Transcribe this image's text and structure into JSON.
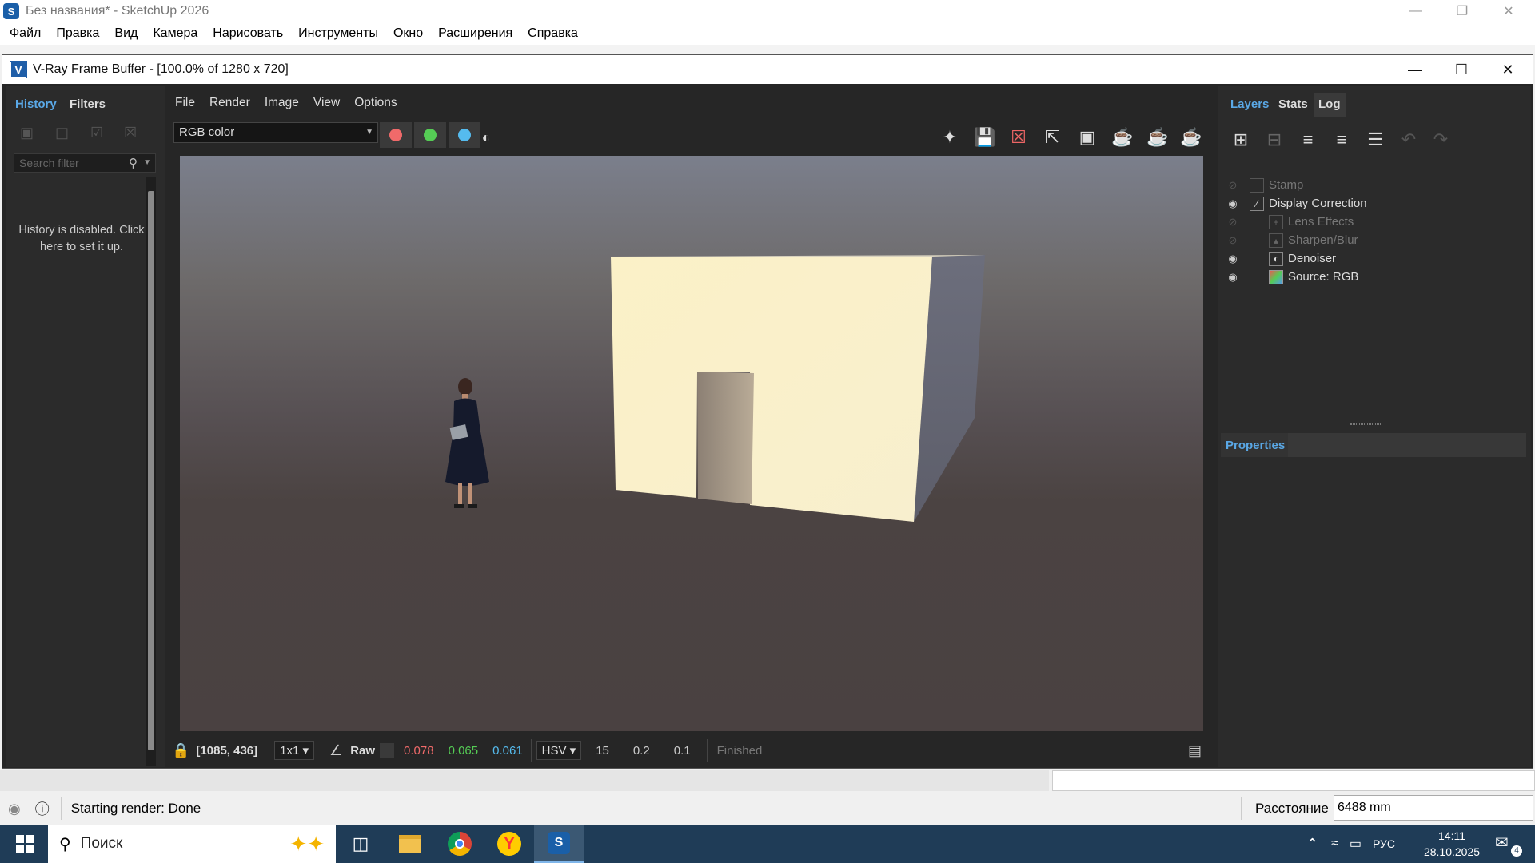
{
  "sketchup": {
    "title": "Без названия* - SketchUp 2026",
    "menu": [
      "Файл",
      "Правка",
      "Вид",
      "Камера",
      "Нарисовать",
      "Инструменты",
      "Окно",
      "Расширения",
      "Справка"
    ],
    "status_text": "Starting render: Done",
    "distance_label": "Расстояние",
    "distance_value": "6488 mm"
  },
  "vfb": {
    "title": "V-Ray Frame Buffer - [100.0% of 1280 x 720]",
    "left_tabs": [
      "History",
      "Filters"
    ],
    "search_placeholder": "Search filter",
    "history_message": "History is disabled. Click here to set it up.",
    "menu": [
      "File",
      "Render",
      "Image",
      "View",
      "Options"
    ],
    "channel": "RGB color",
    "channel_colors": {
      "red": "#f06a6a",
      "green": "#55cc55",
      "blue": "#55bbee"
    },
    "status": {
      "coords": "[1085, 436]",
      "scale": "1x1",
      "raw_label": "Raw",
      "r": "0.078",
      "g": "0.065",
      "b": "0.061",
      "colorspace": "HSV",
      "h": "15",
      "s": "0.2",
      "v": "0.1",
      "state": "Finished"
    },
    "right_tabs": [
      "Layers",
      "Stats",
      "Log"
    ],
    "layers": [
      {
        "name": "Stamp",
        "visible": false,
        "icon": "stamp-icon"
      },
      {
        "name": "Display Correction",
        "visible": true,
        "icon": "curve-icon"
      },
      {
        "name": "Lens Effects",
        "visible": false,
        "icon": "lens-icon"
      },
      {
        "name": "Sharpen/Blur",
        "visible": false,
        "icon": "sharpen-icon"
      },
      {
        "name": "Denoiser",
        "visible": true,
        "icon": "denoiser-icon"
      },
      {
        "name": "Source: RGB",
        "visible": true,
        "icon": "source-icon"
      }
    ],
    "properties_label": "Properties"
  },
  "taskbar": {
    "search_label": "Поиск",
    "lang": "РУС",
    "time": "14:11",
    "date": "28.10.2025",
    "notif_count": "4"
  }
}
